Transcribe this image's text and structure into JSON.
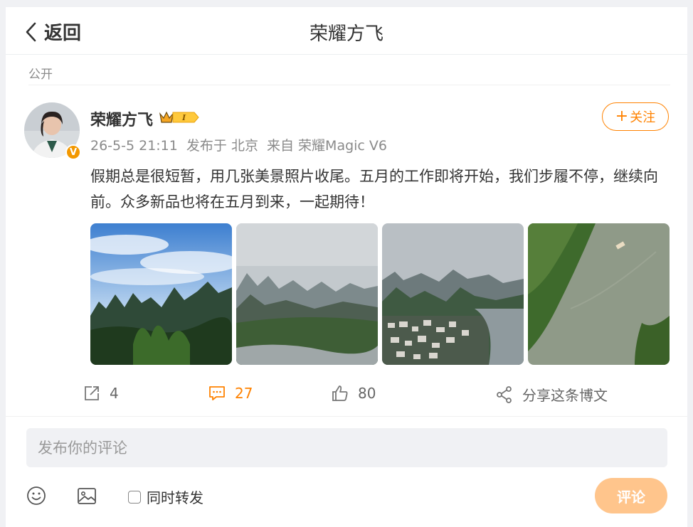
{
  "header": {
    "back_label": "返回",
    "title": "荣耀方飞"
  },
  "post": {
    "visibility": "公开",
    "author": {
      "name": "荣耀方飞",
      "verified_badge": "V"
    },
    "meta": {
      "time": "26-5-5 21:11",
      "location": "发布于 北京",
      "source": "来自 荣耀Magic V6"
    },
    "follow": {
      "plus": "+",
      "label": "关注"
    },
    "text": "假期总是很短暂，用几张美景照片收尾。五月的工作即将开始，我们步履不停，继续向前。众多新品也将在五月到来，一起期待！",
    "photos": [
      "karst-peaks-blue-sky",
      "misty-river-valley",
      "river-town-mountains",
      "aerial-river-boat"
    ]
  },
  "actions": {
    "repost": {
      "icon": "share-out-icon",
      "count": "4"
    },
    "comment": {
      "icon": "comment-icon",
      "count": "27"
    },
    "like": {
      "icon": "thumbs-up-icon",
      "count": "80"
    },
    "share": {
      "icon": "share-nodes-icon",
      "label": "分享这条博文"
    }
  },
  "comment_box": {
    "placeholder": "发布你的评论",
    "repost_label": "同时转发",
    "submit_label": "评论"
  },
  "colors": {
    "accent": "#ff8200",
    "muted": "#8a8a8a",
    "submit_disabled": "#ffc58c"
  }
}
